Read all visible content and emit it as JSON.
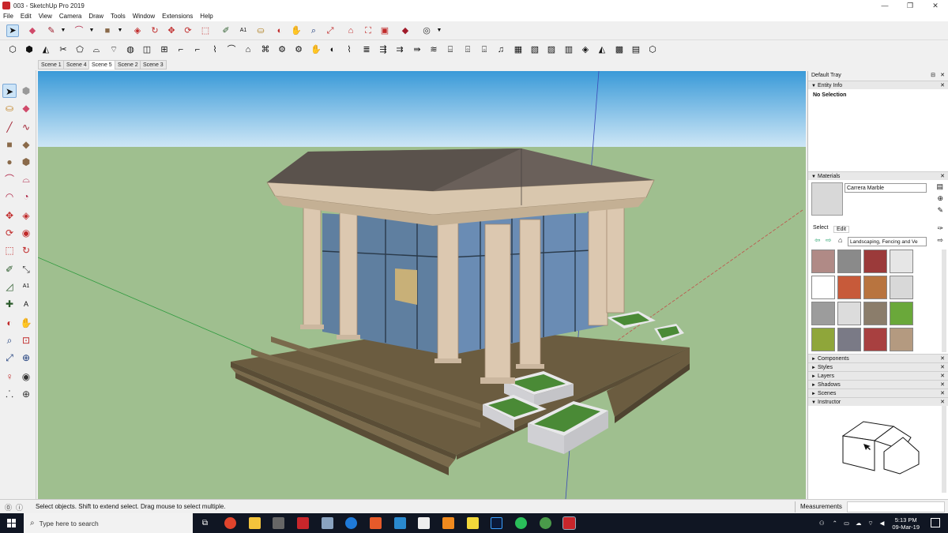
{
  "window": {
    "title": "003 - SketchUp Pro 2019",
    "minimize": "—",
    "maximize": "❐",
    "close": "✕"
  },
  "menu": [
    "File",
    "Edit",
    "View",
    "Camera",
    "Draw",
    "Tools",
    "Window",
    "Extensions",
    "Help"
  ],
  "scenes": [
    "Scene 1",
    "Scene 4",
    "Scene 5",
    "Scene 2",
    "Scene 3"
  ],
  "active_scene": "Scene 5",
  "tray": {
    "title": "Default Tray",
    "entity_info": {
      "label": "Entity Info",
      "value": "No Selection"
    },
    "materials": {
      "label": "Materials",
      "name_value": "Carrera Marble",
      "tabs": [
        "Select",
        "Edit"
      ],
      "library": "Landscaping, Fencing and Ve",
      "swatches": [
        "#b08a86",
        "#8a8a8a",
        "#9b3a3a",
        "#e6e6e6",
        "#ffffff",
        "#c75a3a",
        "#b8743f",
        "#d8d8d8",
        "#9c9c9c",
        "#dcdcdc",
        "#8b7d6b",
        "#6aa83a",
        "#8fa63a",
        "#7a7a86",
        "#a84040",
        "#b49a80"
      ]
    },
    "panels": [
      "Components",
      "Styles",
      "Layers",
      "Shadows",
      "Scenes",
      "Instructor"
    ]
  },
  "status": {
    "message": "Select objects. Shift to extend select. Drag mouse to select multiple.",
    "measurements_label": "Measurements"
  },
  "taskbar": {
    "search_placeholder": "Type here to search",
    "time": "5:13 PM",
    "date": "09-Mar-19"
  }
}
